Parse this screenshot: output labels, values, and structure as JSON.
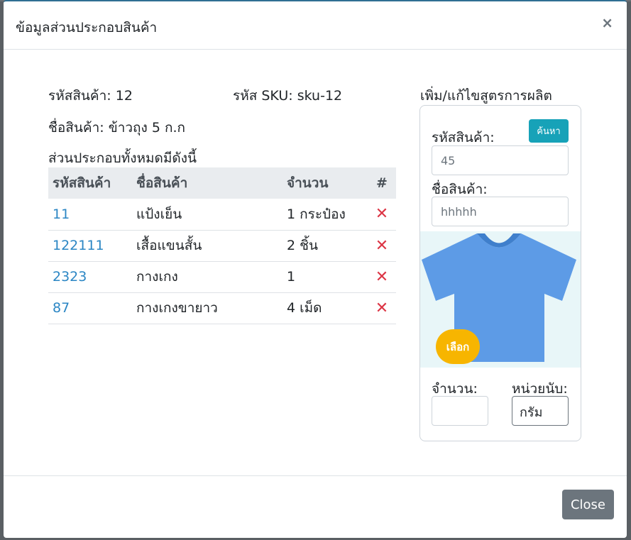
{
  "modal": {
    "title": "ข้อมูลส่วนประกอบสินค้า",
    "close_glyph": "×"
  },
  "product": {
    "code_label": "รหัสสินค้า: 12",
    "sku_label": "รหัส SKU: sku-12",
    "name_label": "ชื่อสินค้า: ข้าวถุง 5 ก.ก",
    "components_heading": "ส่วนประกอบทั้งหมดมีดังนี้"
  },
  "table": {
    "headers": [
      "รหัสสินค้า",
      "ชื่อสินค้า",
      "จำนวน",
      "#"
    ],
    "rows": [
      {
        "code": "11",
        "name": "แป้งเย็น",
        "qty": "1 กระป๋อง",
        "del": "✕"
      },
      {
        "code": "122111",
        "name": "เสื้อแขนสั้น",
        "qty": "2 ชิ้น",
        "del": "✕"
      },
      {
        "code": "2323",
        "name": "กางเกง",
        "qty": "1",
        "del": "✕"
      },
      {
        "code": "87",
        "name": "กางเกงขายาว",
        "qty": "4 เม็ด",
        "del": "✕"
      }
    ]
  },
  "formula_panel": {
    "title": "เพิ่ม/แก้ไขสูตรการผลิต",
    "code_label": "รหัสสินค้า:",
    "search_button": "ค้นหา",
    "code_value": "45",
    "name_label": "ชื่อสินค้า:",
    "name_value": "hhhhh",
    "select_button": "เลือก",
    "qty_label": "จำนวน:",
    "qty_value": "",
    "unit_label": "หน่วยนับ:",
    "unit_value": "กรัม",
    "image_icon": "t-shirt-icon"
  },
  "footer": {
    "close_button": "Close"
  },
  "colors": {
    "link": "#2b86c4",
    "delete": "#dc3545",
    "search_button": "#17a2b8",
    "select_button": "#f7b500",
    "close_button": "#6c757d",
    "shirt": "#5d9be6"
  }
}
